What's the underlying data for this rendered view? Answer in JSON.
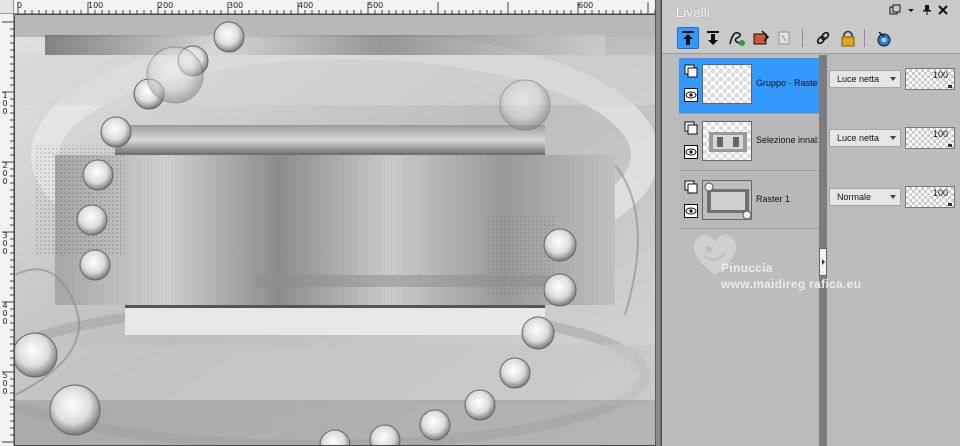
{
  "panel": {
    "title": "Livelli",
    "titlebar_buttons": [
      "restore-icon",
      "dropdown-icon",
      "pin-icon",
      "close-icon"
    ],
    "toolbar_icons": [
      "move-layer-up-icon",
      "move-layer-down-icon",
      "new-layer-icon",
      "layer-properties-icon",
      "duplicate-icon",
      "link-icon",
      "lock-icon",
      "mask-icon"
    ]
  },
  "rulers": {
    "top": [
      "0",
      "100",
      "200",
      "300",
      "400",
      "500",
      "600"
    ],
    "left": [
      "1\n0\n0",
      "2\n0\n0",
      "3\n0\n0",
      "4\n0\n0",
      "5\n0\n0"
    ]
  },
  "layers": [
    {
      "name": "Gruppo - Raster",
      "blend_mode": "Luce netta",
      "opacity": "100",
      "selected": true
    },
    {
      "name": "Selezione innalz",
      "blend_mode": "Luce netta",
      "opacity": "100",
      "selected": false
    },
    {
      "name": "Raster 1",
      "blend_mode": "Normale",
      "opacity": "100",
      "selected": false
    }
  ],
  "watermark": {
    "name": "Pinuccia",
    "url": "www.maidireg rafica.eu"
  },
  "colors": {
    "selected_row": "#3399ff",
    "panel_bg": "#bcbcbc",
    "scrollbar": "#7c7c7c"
  }
}
